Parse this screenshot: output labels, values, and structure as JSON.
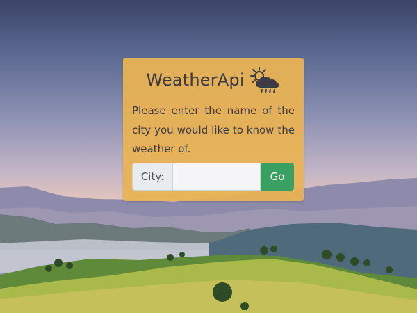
{
  "app": {
    "title": "WeatherApi",
    "title_icon": "sun-behind-rain-cloud-icon"
  },
  "form": {
    "description": "Please enter the name of the city you would like to know the weather of.",
    "city_label": "City:",
    "city_value": "",
    "city_placeholder": "",
    "submit_label": "Go"
  },
  "colors": {
    "card_background": "#e9b254",
    "text": "#3b3a45",
    "go_button": "#3aa062",
    "label_background": "#e9ecef"
  }
}
